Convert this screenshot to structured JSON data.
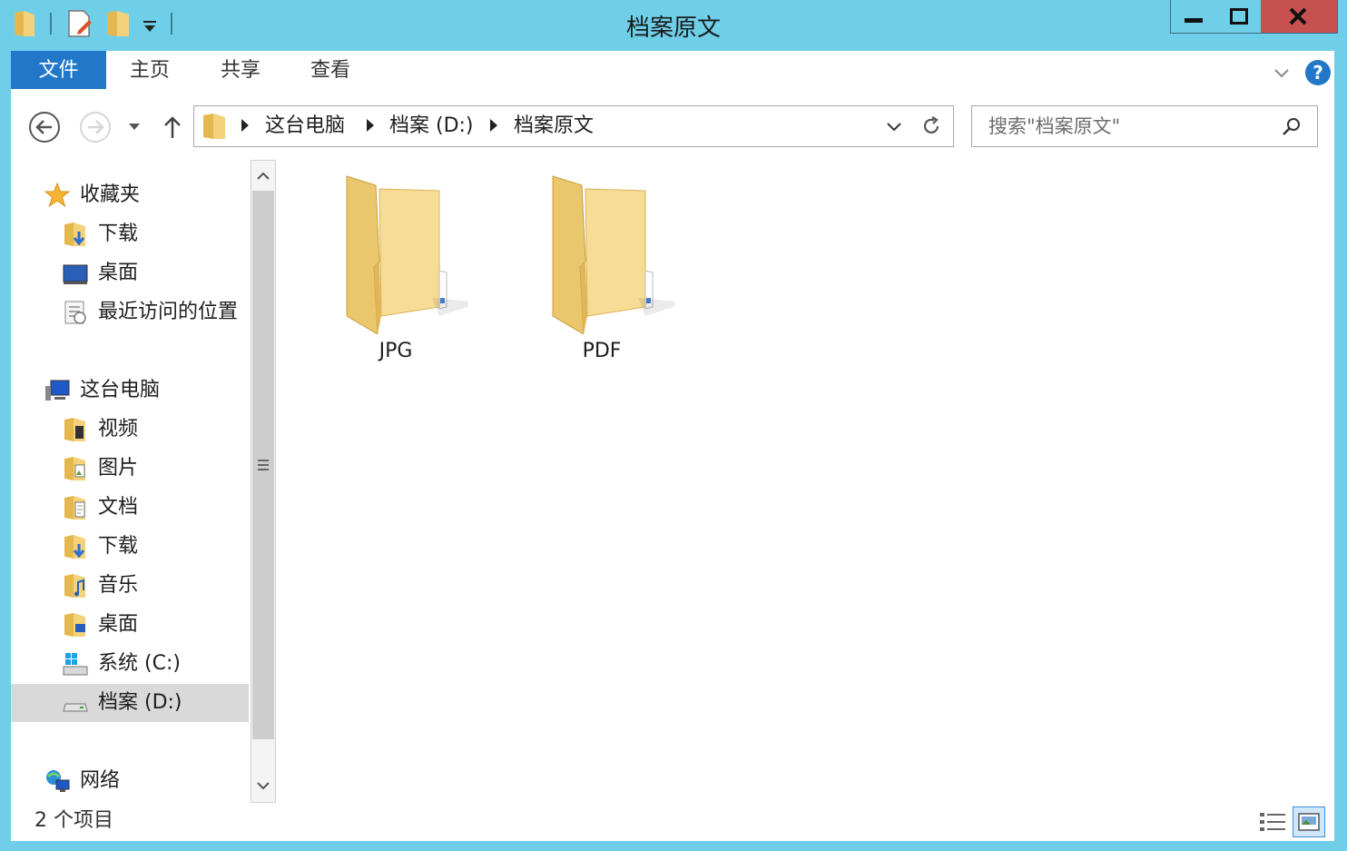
{
  "window": {
    "title": "档案原文"
  },
  "ribbon": {
    "tabs": [
      {
        "label": "文件"
      },
      {
        "label": "主页"
      },
      {
        "label": "共享"
      },
      {
        "label": "查看"
      }
    ],
    "help_label": "?"
  },
  "address": {
    "crumbs": [
      "这台电脑",
      "档案 (D:)",
      "档案原文"
    ]
  },
  "search": {
    "placeholder": "搜索\"档案原文\""
  },
  "nav_pane": {
    "favorites": {
      "label": "收藏夹",
      "items": [
        {
          "label": "下载",
          "icon": "downloads-folder-icon"
        },
        {
          "label": "桌面",
          "icon": "desktop-icon"
        },
        {
          "label": "最近访问的位置",
          "icon": "recent-places-icon"
        }
      ]
    },
    "this_pc": {
      "label": "这台电脑",
      "items": [
        {
          "label": "视频",
          "icon": "videos-folder-icon"
        },
        {
          "label": "图片",
          "icon": "pictures-folder-icon"
        },
        {
          "label": "文档",
          "icon": "documents-folder-icon"
        },
        {
          "label": "下载",
          "icon": "downloads-folder-icon"
        },
        {
          "label": "音乐",
          "icon": "music-folder-icon"
        },
        {
          "label": "桌面",
          "icon": "desktop-folder-icon"
        },
        {
          "label": "系统 (C:)",
          "icon": "system-drive-icon"
        },
        {
          "label": "档案 (D:)",
          "icon": "drive-icon"
        }
      ]
    },
    "network": {
      "label": "网络"
    }
  },
  "content": {
    "items": [
      {
        "name": "JPG"
      },
      {
        "name": "PDF"
      }
    ]
  },
  "status": {
    "item_count": "2 个项目"
  },
  "colors": {
    "titlebar": "#6fcfe9",
    "file_tab": "#2178c9",
    "close_button": "#c75050",
    "folder": "#f3d27a"
  }
}
